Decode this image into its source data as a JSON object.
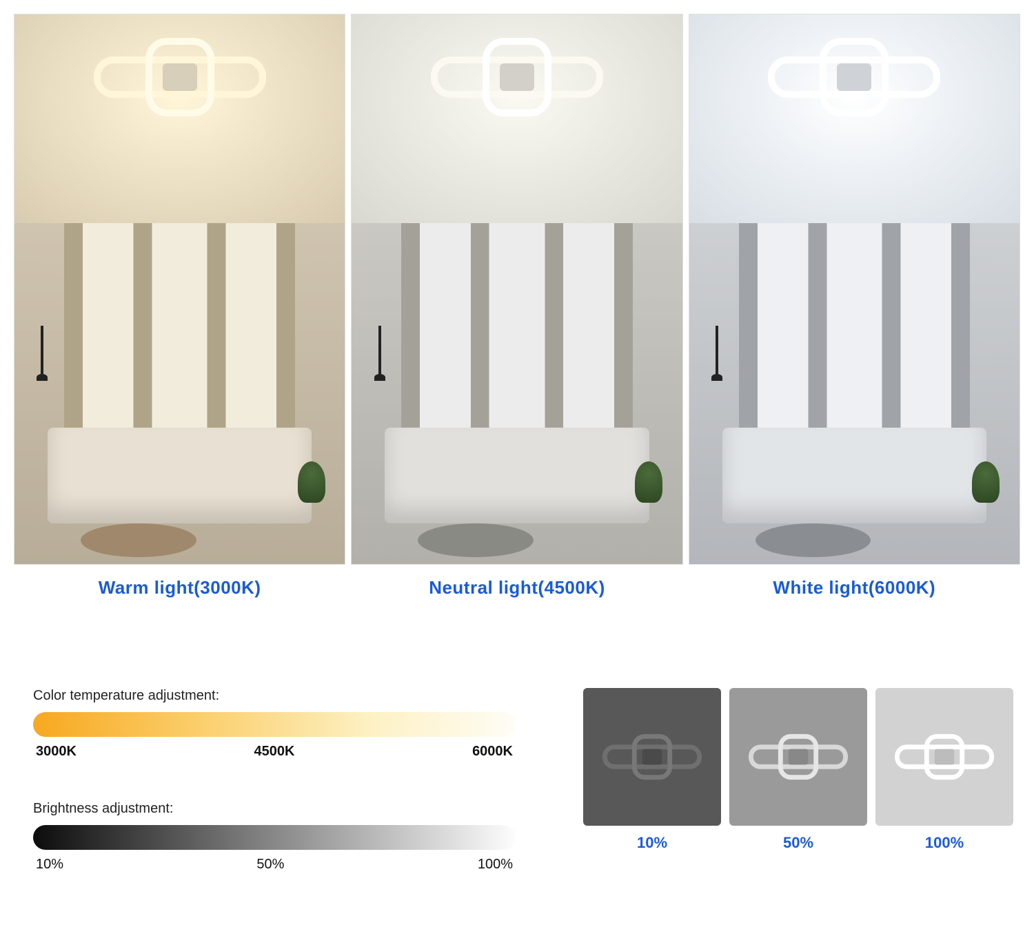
{
  "scenes": [
    {
      "caption": "Warm light(3000K)"
    },
    {
      "caption": "Neutral light(4500K)"
    },
    {
      "caption": "White light(6000K)"
    }
  ],
  "colorTemp": {
    "label": "Color temperature adjustment:",
    "ticks": [
      "3000K",
      "4500K",
      "6000K"
    ]
  },
  "brightness": {
    "label": "Brightness adjustment:",
    "ticks": [
      "10%",
      "50%",
      "100%"
    ]
  },
  "thumbs": [
    {
      "caption": "10%"
    },
    {
      "caption": "50%"
    },
    {
      "caption": "100%"
    }
  ],
  "colors": {
    "accentBlue": "#1a5bd6"
  }
}
